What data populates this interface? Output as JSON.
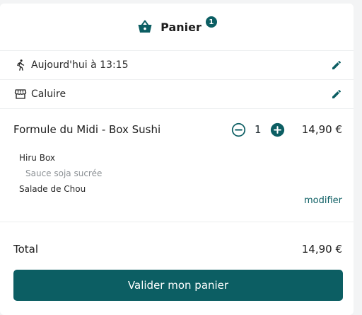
{
  "header": {
    "title": "Panier",
    "badge_count": "1",
    "icon": "basket-icon"
  },
  "pickup": {
    "time_text": "Aujourd'hui à 13:15",
    "icon": "walking-person-icon",
    "edit_icon": "pencil-icon"
  },
  "store": {
    "name": "Caluire",
    "icon": "storefront-icon",
    "edit_icon": "pencil-icon"
  },
  "item": {
    "name": "Formule du Midi - Box Sushi",
    "quantity": "1",
    "price": "14,90 €",
    "options": [
      {
        "label": "Hiru Box"
      },
      {
        "label": "Sauce soja sucrée"
      },
      {
        "label": "Salade de Chou"
      }
    ],
    "modify_label": "modifier"
  },
  "total": {
    "label": "Total",
    "value": "14,90 €"
  },
  "submit_label": "Valider mon panier",
  "colors": {
    "accent": "#0c5e63"
  }
}
